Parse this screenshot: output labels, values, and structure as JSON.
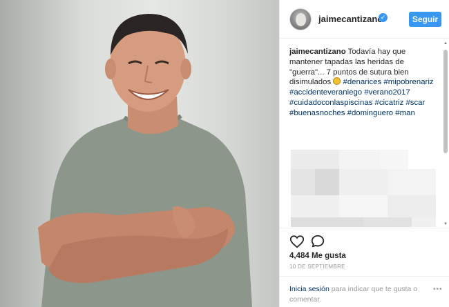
{
  "post": {
    "username": "jaimecantizano",
    "follow_label": "Seguir",
    "caption_user": "jaimecantizano",
    "caption_text": " Todavía hay que mantener tapadas las heridas de \"guerra\"... 7 puntos de sutura bien disimulados ",
    "hashtags": [
      "#denarices",
      "#mipobrenariz",
      "#accidenteveraniego",
      "#verano2017",
      "#cuidadoconlaspiscinas",
      "#cicatriz",
      "#scar",
      "#buenasnoches",
      "#dominguero",
      "#man"
    ],
    "likes": "4,484 Me gusta",
    "date": "10 DE SEPTIEMBRE",
    "login_link": "Inicia sesión",
    "login_rest": " para indicar que te gusta o comentar."
  },
  "icons": {
    "verified": "verified-badge-icon",
    "like": "heart-outline-icon",
    "comment": "comment-bubble-icon",
    "more": "ellipsis-icon"
  },
  "colors": {
    "accent": "#3897f0",
    "hashtag": "#003569",
    "text": "#262626",
    "muted": "#999999"
  }
}
